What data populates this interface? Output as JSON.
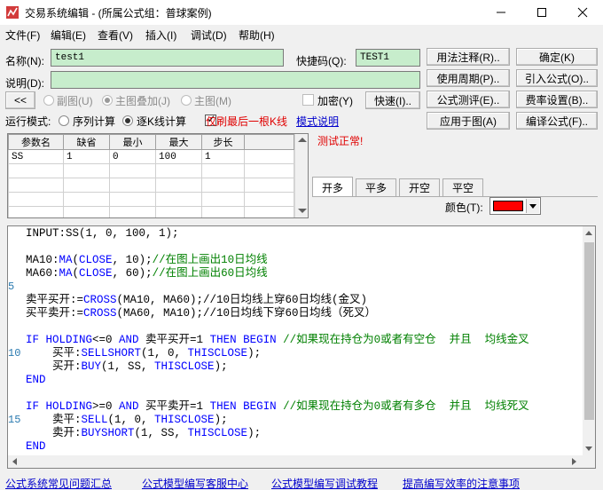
{
  "window": {
    "title": "交易系统编辑 - (所属公式组：普球案例)",
    "controls": [
      "minimize",
      "maximize",
      "close"
    ]
  },
  "menu": [
    "文件(F)",
    "编辑(E)",
    "查看(V)",
    "插入(I)",
    "调试(D)",
    "帮助(H)"
  ],
  "form": {
    "name_label": "名称(N):",
    "name_value": "test1",
    "shortcut_label": "快捷码(Q):",
    "shortcut_value": "TEST1",
    "desc_label": "说明(D):",
    "desc_value": ""
  },
  "right_buttons": [
    "用法注释(R)..",
    "确定(K)",
    "使用周期(P)..",
    "引入公式(O)..",
    "公式测评(E)..",
    "费率设置(B)..",
    "应用于图(A)",
    "编译公式(F).."
  ],
  "toolbar": {
    "collapse_button": "<<",
    "chart_options": [
      {
        "label": "副图(U)",
        "selected": false
      },
      {
        "label": "主图叠加(J)",
        "selected": true
      },
      {
        "label": "主图(M)",
        "selected": false
      }
    ],
    "encrypt_label": "加密(Y)",
    "quick_button": "快速(I).."
  },
  "run_mode": {
    "label": "运行模式:",
    "options": [
      {
        "label": "序列计算",
        "selected": false
      },
      {
        "label": "逐K线计算",
        "selected": true
      }
    ],
    "refresh_last_label": "仅刷最后一根K线",
    "refresh_last_checked": true,
    "mode_help_link": "模式说明"
  },
  "params": {
    "headers": [
      "参数名",
      "缺省",
      "最小",
      "最大",
      "步长"
    ],
    "rows": [
      [
        "SS",
        "1",
        "0",
        "100",
        "1"
      ],
      [
        "",
        "",
        "",
        "",
        ""
      ],
      [
        "",
        "",
        "",
        "",
        ""
      ],
      [
        "",
        "",
        "",
        "",
        ""
      ],
      [
        "",
        "",
        "",
        "",
        ""
      ]
    ]
  },
  "test_status": "测试正常!",
  "signal_tabs": [
    "开多",
    "平多",
    "开空",
    "平空"
  ],
  "color_label": "颜色(T):",
  "signal_color": "#ff0000",
  "line_numbers": [
    {
      "n": "5",
      "line": 5
    },
    {
      "n": "10",
      "line": 10
    },
    {
      "n": "15",
      "line": 15
    }
  ],
  "code": [
    [
      [
        "",
        "INPUT:SS(1, 0, 100, 1);"
      ]
    ],
    [],
    [
      [
        "",
        "MA10:"
      ],
      [
        "fn",
        "MA"
      ],
      [
        "",
        "("
      ],
      [
        "fn",
        "CLOSE"
      ],
      [
        "",
        ", 10);"
      ],
      [
        "cm",
        "//在图上画出10日均线"
      ]
    ],
    [
      [
        "",
        "MA60:"
      ],
      [
        "fn",
        "MA"
      ],
      [
        "",
        "("
      ],
      [
        "fn",
        "CLOSE"
      ],
      [
        "",
        ", 60);"
      ],
      [
        "cm",
        "//在图上画出60日均线"
      ]
    ],
    [],
    [
      [
        "",
        "卖平买开:="
      ],
      [
        "fn",
        "CROSS"
      ],
      [
        "",
        "(MA10, MA60);//10日均线上穿60日均线(金叉)"
      ]
    ],
    [
      [
        "",
        "买平卖开:="
      ],
      [
        "fn",
        "CROSS"
      ],
      [
        "",
        "(MA60, MA10);//10日均线下穿60日均线（死叉）"
      ]
    ],
    [],
    [
      [
        "kw",
        "IF HOLDING"
      ],
      [
        "",
        "<=0 "
      ],
      [
        "kw",
        "AND"
      ],
      [
        "",
        " 卖平买开=1 "
      ],
      [
        "kw",
        "THEN BEGIN"
      ],
      [
        "cm",
        " //如果现在持仓为0或者有空仓  并且  均线金叉"
      ]
    ],
    [
      [
        "",
        "    买平:"
      ],
      [
        "fn",
        "SELLSHORT"
      ],
      [
        "",
        "(1, 0, "
      ],
      [
        "fn",
        "THISCLOSE"
      ],
      [
        "",
        ");"
      ]
    ],
    [
      [
        "",
        "    买开:"
      ],
      [
        "fn",
        "BUY"
      ],
      [
        "",
        "(1, SS, "
      ],
      [
        "fn",
        "THISCLOSE"
      ],
      [
        "",
        ");"
      ]
    ],
    [
      [
        "kw",
        "END"
      ]
    ],
    [],
    [
      [
        "kw",
        "IF HOLDING"
      ],
      [
        "",
        ">=0 "
      ],
      [
        "kw",
        "AND"
      ],
      [
        "",
        " 买平卖开=1 "
      ],
      [
        "kw",
        "THEN BEGIN"
      ],
      [
        "cm",
        " //如果现在持仓为0或者有多仓  并且  均线死叉"
      ]
    ],
    [
      [
        "",
        "    卖平:"
      ],
      [
        "fn",
        "SELL"
      ],
      [
        "",
        "(1, 0, "
      ],
      [
        "fn",
        "THISCLOSE"
      ],
      [
        "",
        ");"
      ]
    ],
    [
      [
        "",
        "    卖开:"
      ],
      [
        "fn",
        "BUYSHORT"
      ],
      [
        "",
        "(1, SS, "
      ],
      [
        "fn",
        "THISCLOSE"
      ],
      [
        "",
        ");"
      ]
    ],
    [
      [
        "kw",
        "END"
      ]
    ]
  ],
  "footer_links": [
    "公式系统常见问题汇总",
    "公式模型编写客服中心",
    "公式模型编写调试教程",
    "提高编写效率的注意事项"
  ]
}
